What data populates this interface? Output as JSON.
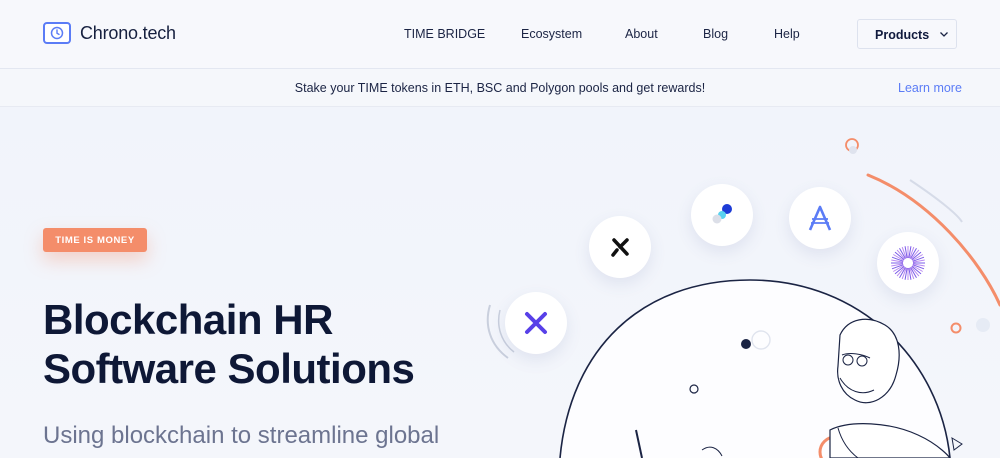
{
  "brand": {
    "name": "Chrono.tech"
  },
  "nav": {
    "items": [
      "TIME BRIDGE",
      "Ecosystem",
      "About",
      "Blog",
      "Help"
    ],
    "products_label": "Products"
  },
  "banner": {
    "text": "Stake your TIME tokens in ETH, BSC and Polygon pools and get rewards!",
    "link": "Learn more"
  },
  "hero": {
    "badge": "TIME IS MONEY",
    "title_line1": "Blockchain HR",
    "title_line2": "Software Solutions",
    "subtitle": "Using blockchain to streamline global"
  },
  "icons": {
    "logo": "clock-icon",
    "products_chevron": "chevron-down-icon",
    "token_1": "x-token-icon",
    "token_2": "dark-x-token-icon",
    "token_3": "dots-token-icon",
    "token_4": "a-token-icon",
    "token_5": "radial-lines-token-icon"
  },
  "colors": {
    "accent": "#5b7cf6",
    "badge": "#f48d6a",
    "heading": "#0e1836"
  }
}
